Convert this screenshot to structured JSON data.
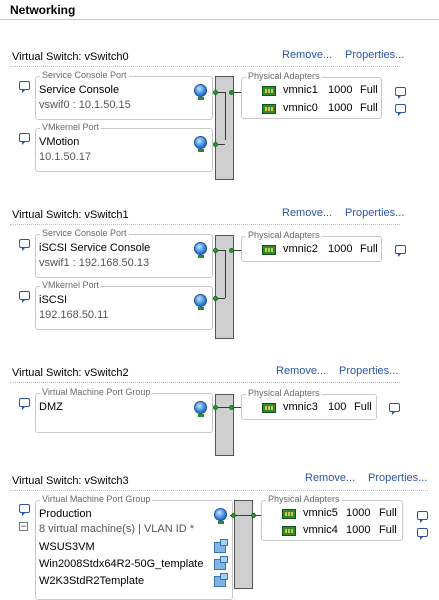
{
  "page": {
    "title": "Networking"
  },
  "switches": [
    {
      "title": "Virtual Switch: vSwitch0",
      "remove": "Remove...",
      "properties": "Properties...",
      "ports": [
        {
          "group_title": "Service Console Port",
          "name": "Service Console",
          "detail": "vswif0 : 10.1.50.15"
        },
        {
          "group_title": "VMkernel Port",
          "name": "VMotion",
          "detail": "10.1.50.17"
        }
      ],
      "adapters_title": "Physical Adapters",
      "adapters": [
        {
          "name": "vmnic1",
          "speed": "1000",
          "duplex": "Full"
        },
        {
          "name": "vmnic0",
          "speed": "1000",
          "duplex": "Full"
        }
      ]
    },
    {
      "title": "Virtual Switch: vSwitch1",
      "remove": "Remove...",
      "properties": "Properties...",
      "ports": [
        {
          "group_title": "Service Console Port",
          "name": "iSCSI Service Console",
          "detail": "vswif1 : 192.168.50.13"
        },
        {
          "group_title": "VMkernel Port",
          "name": "iSCSI",
          "detail": "192.168.50.11"
        }
      ],
      "adapters_title": "Physical Adapters",
      "adapters": [
        {
          "name": "vmnic2",
          "speed": "1000",
          "duplex": "Full"
        }
      ]
    },
    {
      "title": "Virtual Switch: vSwitch2",
      "remove": "Remove...",
      "properties": "Properties...",
      "ports": [
        {
          "group_title": "Virtual Machine Port Group",
          "name": "DMZ",
          "detail": ""
        }
      ],
      "adapters_title": "Physical Adapters",
      "adapters": [
        {
          "name": "vmnic3",
          "speed": "100",
          "duplex": "Full"
        }
      ]
    },
    {
      "title": "Virtual Switch: vSwitch3",
      "remove": "Remove...",
      "properties": "Properties...",
      "ports": [
        {
          "group_title": "Virtual Machine Port Group",
          "name": "Production",
          "detail": "8 virtual machine(s) | VLAN ID *"
        }
      ],
      "expand_symbol": "−",
      "vms": [
        "WSUS3VM",
        "Win2008Stdx64R2-50G_template",
        "W2K3StdR2Template"
      ],
      "adapters_title": "Physical Adapters",
      "adapters": [
        {
          "name": "vmnic5",
          "speed": "1000",
          "duplex": "Full"
        },
        {
          "name": "vmnic4",
          "speed": "1000",
          "duplex": "Full"
        }
      ]
    }
  ]
}
